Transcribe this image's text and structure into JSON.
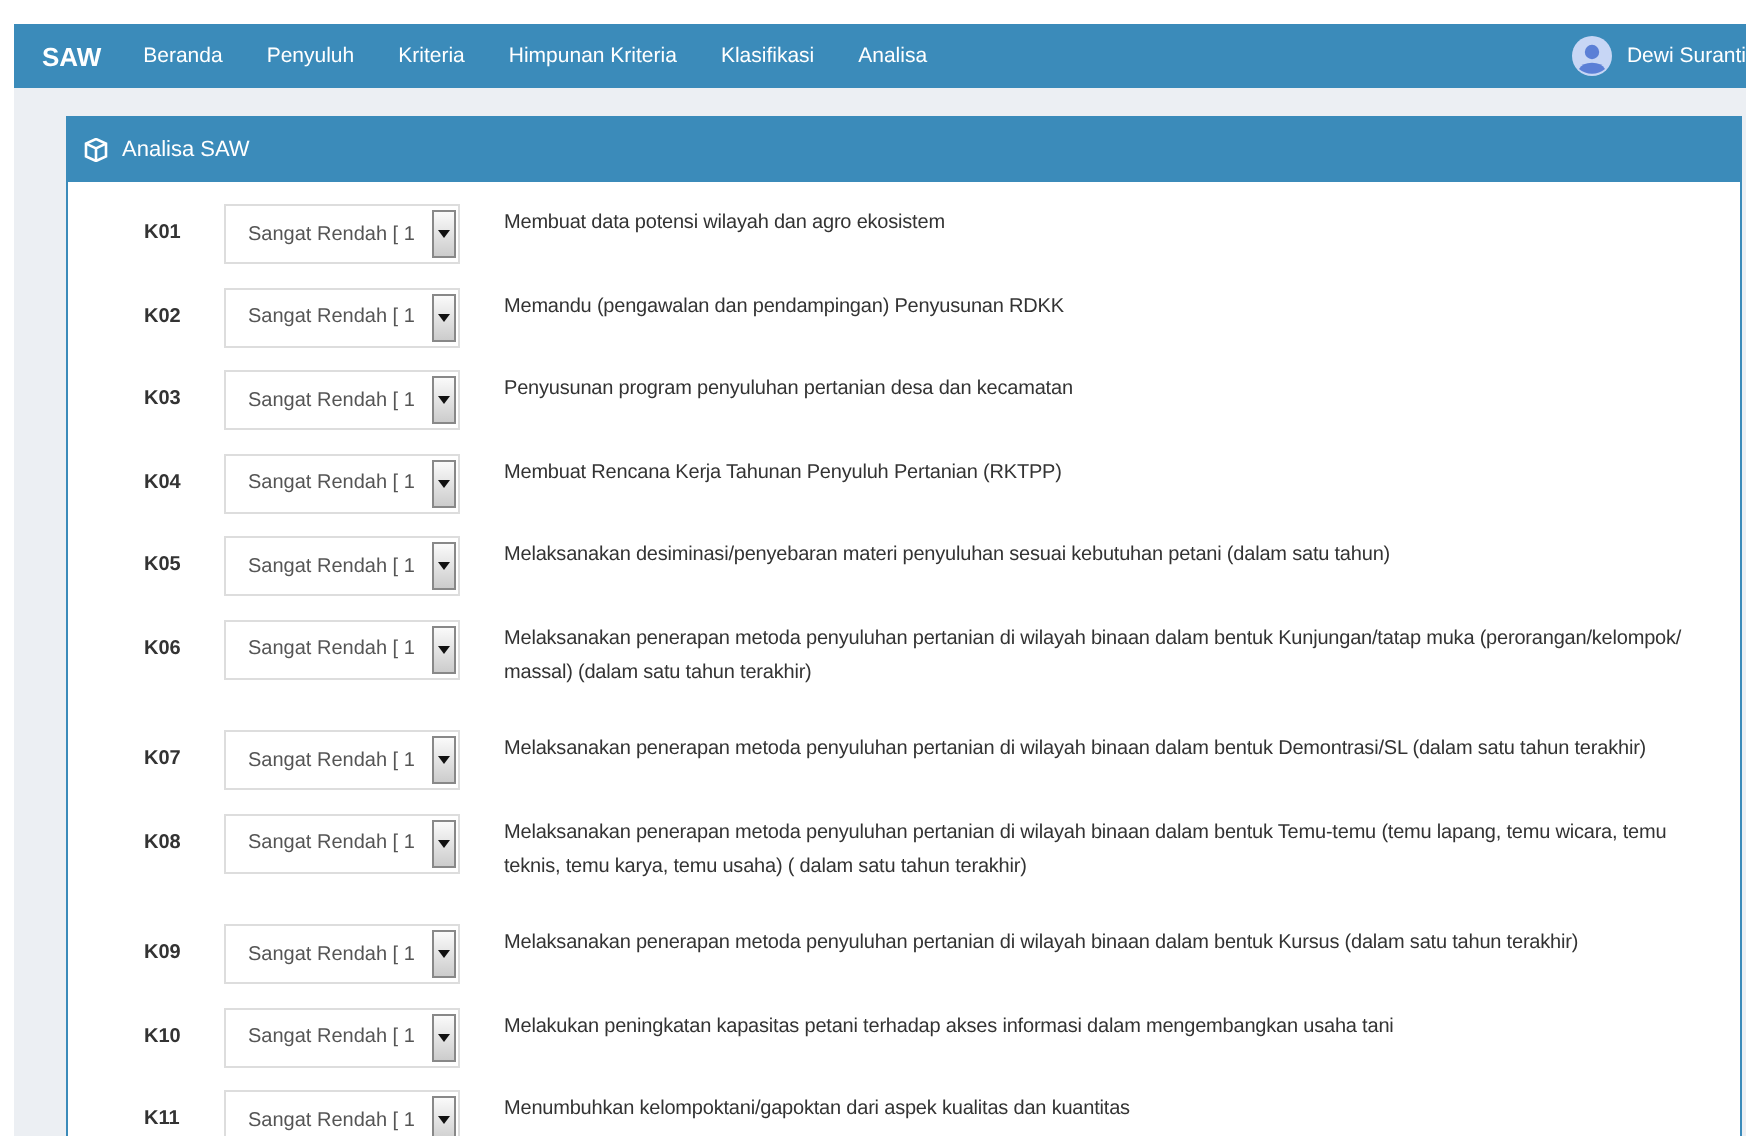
{
  "navbar": {
    "brand": "SAW",
    "items": [
      "Beranda",
      "Penyuluh",
      "Kriteria",
      "Himpunan Kriteria",
      "Klasifikasi",
      "Analisa"
    ],
    "user": "Dewi Suranti"
  },
  "panel": {
    "title": "Analisa SAW",
    "criteria": [
      {
        "code": "K01",
        "value": "Sangat Rendah [ 1",
        "description": "Membuat data potensi wilayah dan agro ekosistem"
      },
      {
        "code": "K02",
        "value": "Sangat Rendah [ 1",
        "description": "Memandu (pengawalan dan pendampingan) Penyusunan RDKK"
      },
      {
        "code": "K03",
        "value": "Sangat Rendah [ 1",
        "description": "Penyusunan program penyuluhan pertanian desa dan kecamatan"
      },
      {
        "code": "K04",
        "value": "Sangat Rendah [ 1",
        "description": "Membuat Rencana Kerja Tahunan Penyuluh Pertanian (RKTPP)"
      },
      {
        "code": "K05",
        "value": "Sangat Rendah [ 1",
        "description": "Melaksanakan desiminasi/penyebaran materi penyuluhan sesuai kebutuhan petani (dalam satu tahun)"
      },
      {
        "code": "K06",
        "value": "Sangat Rendah [ 1",
        "description": "Melaksanakan penerapan metoda penyuluhan pertanian di wilayah binaan dalam bentuk Kunjungan/tatap muka (perorangan/kelompok/ massal) (dalam satu tahun terakhir)"
      },
      {
        "code": "K07",
        "value": "Sangat Rendah [ 1",
        "description": "Melaksanakan penerapan metoda penyuluhan pertanian di wilayah binaan dalam bentuk Demontrasi/SL (dalam satu tahun terakhir)"
      },
      {
        "code": "K08",
        "value": "Sangat Rendah [ 1",
        "description": "Melaksanakan penerapan metoda penyuluhan pertanian di wilayah binaan dalam bentuk Temu-temu (temu lapang, temu wicara, temu teknis, temu karya, temu usaha) ( dalam satu tahun terakhir)"
      },
      {
        "code": "K09",
        "value": "Sangat Rendah [ 1",
        "description": "Melaksanakan penerapan metoda penyuluhan pertanian di wilayah binaan dalam bentuk Kursus (dalam satu tahun terakhir)"
      },
      {
        "code": "K10",
        "value": "Sangat Rendah [ 1",
        "description": "Melakukan peningkatan kapasitas petani terhadap akses informasi dalam mengembangkan usaha tani"
      },
      {
        "code": "K11",
        "value": "Sangat Rendah [ 1",
        "description": "Menumbuhkan kelompoktani/gapoktan dari aspek kualitas dan kuantitas"
      }
    ]
  }
}
